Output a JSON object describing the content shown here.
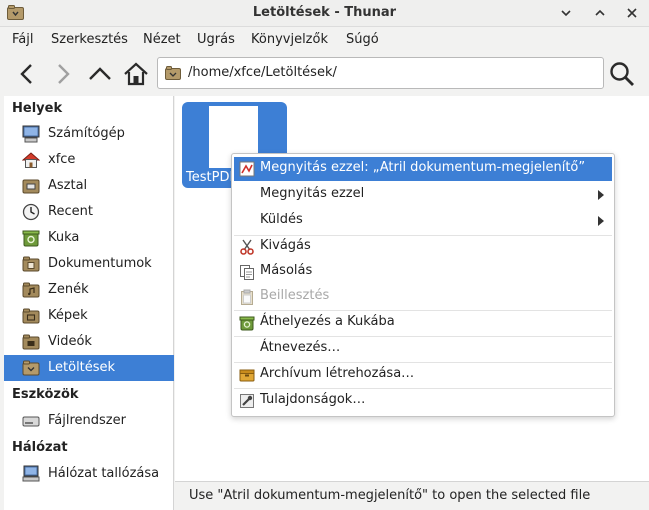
{
  "window": {
    "title": "Letöltések - Thunar"
  },
  "menubar": [
    "Fájl",
    "Szerkesztés",
    "Nézet",
    "Ugrás",
    "Könyvjelzők",
    "Súgó"
  ],
  "location": {
    "path": "/home/xfce/Letöltések/"
  },
  "sidebar": {
    "sections": [
      {
        "heading": "Helyek",
        "items": [
          {
            "label": "Számítógép",
            "icon": "computer-icon"
          },
          {
            "label": "xfce",
            "icon": "home-icon"
          },
          {
            "label": "Asztal",
            "icon": "desktop-icon"
          },
          {
            "label": "Recent",
            "icon": "clock-icon"
          },
          {
            "label": "Kuka",
            "icon": "trash-icon"
          },
          {
            "label": "Dokumentumok",
            "icon": "folder-documents-icon"
          },
          {
            "label": "Zenék",
            "icon": "folder-music-icon"
          },
          {
            "label": "Képek",
            "icon": "folder-pictures-icon"
          },
          {
            "label": "Videók",
            "icon": "folder-videos-icon"
          },
          {
            "label": "Letöltések",
            "icon": "folder-downloads-icon",
            "selected": true
          }
        ]
      },
      {
        "heading": "Eszközök",
        "items": [
          {
            "label": "Fájlrendszer",
            "icon": "drive-icon"
          }
        ]
      },
      {
        "heading": "Hálózat",
        "items": [
          {
            "label": "Hálózat tallózása",
            "icon": "network-icon"
          }
        ]
      }
    ]
  },
  "main": {
    "file_label": "TestPDF"
  },
  "context_menu": {
    "items": [
      {
        "label": "Megnyitás ezzel: „Atril dokumentum-megjelenítő”",
        "icon": "atril-icon",
        "highlighted": true
      },
      {
        "label": "Megnyitás ezzel",
        "submenu": true
      },
      {
        "label": "Küldés",
        "submenu": true
      },
      {
        "label": "Kivágás",
        "icon": "cut-icon"
      },
      {
        "label": "Másolás",
        "icon": "copy-icon"
      },
      {
        "label": "Beillesztés",
        "icon": "paste-icon",
        "disabled": true
      },
      {
        "label": "Áthelyezés a Kukába",
        "icon": "trash-icon"
      },
      {
        "label": "Átnevezés…"
      },
      {
        "label": "Archívum létrehozása…",
        "icon": "archive-icon"
      },
      {
        "label": "Tulajdonságok…",
        "icon": "properties-icon"
      }
    ]
  },
  "statusbar": {
    "text": "Use \"Atril dokumentum-megjelenítő\" to open the selected file"
  },
  "colors": {
    "selection": "#3d7fd5",
    "folder": "#a38a5c"
  }
}
